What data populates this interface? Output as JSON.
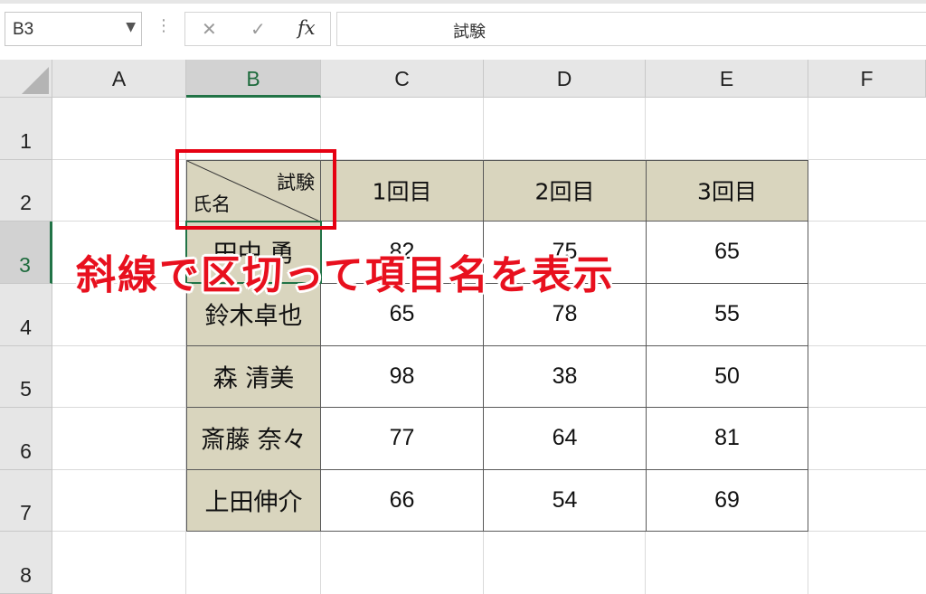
{
  "formula_bar": {
    "name_box": "B3",
    "cancel_glyph": "✕",
    "enter_glyph": "✓",
    "fx_label": "fx",
    "formula_value": "試験"
  },
  "columns": [
    "A",
    "B",
    "C",
    "D",
    "E",
    "F"
  ],
  "rows": [
    "1",
    "2",
    "3",
    "4",
    "5",
    "6",
    "7",
    "8"
  ],
  "selected": {
    "column": "B",
    "row": "3"
  },
  "table": {
    "diagonal_header": {
      "top_right": "試験",
      "bottom_left": "氏名"
    },
    "headers": [
      "1回目",
      "2回目",
      "3回目"
    ],
    "records": [
      {
        "name": "田中 勇",
        "scores": [
          "82",
          "75",
          "65"
        ]
      },
      {
        "name": "鈴木卓也",
        "scores": [
          "65",
          "78",
          "55"
        ]
      },
      {
        "name": "森 清美",
        "scores": [
          "98",
          "38",
          "50"
        ]
      },
      {
        "name": "斎藤 奈々",
        "scores": [
          "77",
          "64",
          "81"
        ]
      },
      {
        "name": "上田伸介",
        "scores": [
          "66",
          "54",
          "69"
        ]
      }
    ]
  },
  "annotation": "斜線で区切って項目名を表示",
  "colors": {
    "header_fill": "#d9d5be",
    "highlight": "#e60012",
    "selection": "#217346"
  }
}
